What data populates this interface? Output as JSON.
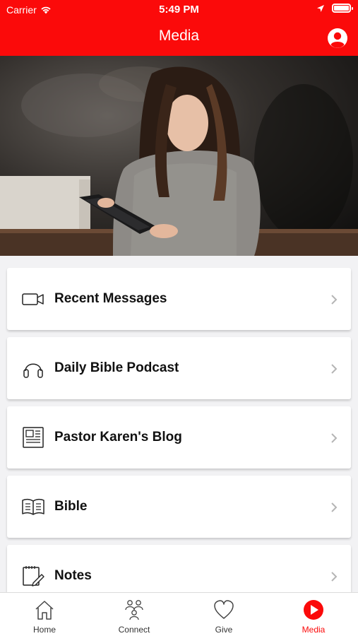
{
  "status_bar": {
    "carrier": "Carrier",
    "time": "5:49 PM"
  },
  "header": {
    "title": "Media"
  },
  "menu": [
    {
      "label": "Recent Messages",
      "icon": "video-camera-icon"
    },
    {
      "label": "Daily Bible Podcast",
      "icon": "headphones-icon"
    },
    {
      "label": "Pastor Karen's Blog",
      "icon": "blog-article-icon"
    },
    {
      "label": "Bible",
      "icon": "open-book-icon"
    },
    {
      "label": "Notes",
      "icon": "notepad-pencil-icon"
    }
  ],
  "tabs": [
    {
      "label": "Home",
      "icon": "home-icon",
      "active": false
    },
    {
      "label": "Connect",
      "icon": "people-group-icon",
      "active": false
    },
    {
      "label": "Give",
      "icon": "heart-icon",
      "active": false
    },
    {
      "label": "Media",
      "icon": "play-icon",
      "active": true
    }
  ],
  "colors": {
    "brand": "#fb0a0a",
    "background": "#f2f2f4",
    "card": "#ffffff"
  }
}
